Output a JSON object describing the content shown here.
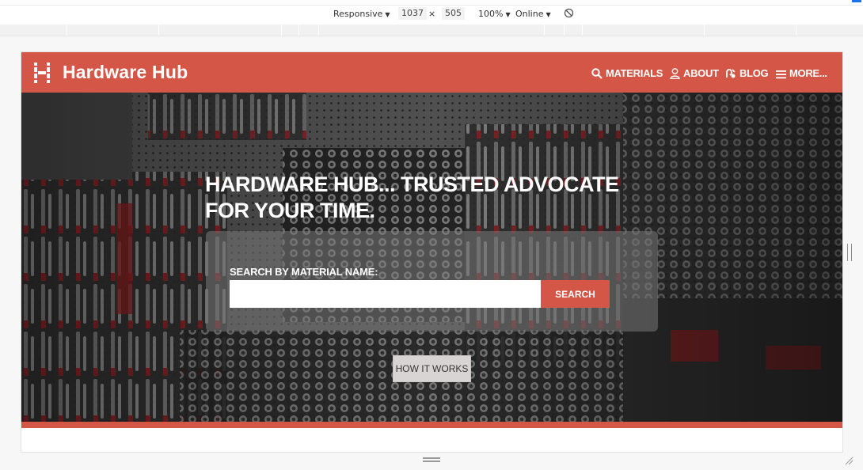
{
  "devtools": {
    "device": "Responsive",
    "width": "1037",
    "times": "×",
    "height": "505",
    "zoom": "100%",
    "network": "Online"
  },
  "site": {
    "brand": "Hardware Hub",
    "nav": [
      {
        "label": "MATERIALS",
        "icon": "search-icon"
      },
      {
        "label": "ABOUT",
        "icon": "user-icon"
      },
      {
        "label": "BLOG",
        "icon": "blog-icon"
      },
      {
        "label": "MORE...",
        "icon": "menu-icon"
      }
    ]
  },
  "hero": {
    "headline": "HARDWARE HUB... TRUSTED ADVOCATE FOR YOUR TIME.",
    "search_label": "SEARCH BY MATERIAL NAME:",
    "search_placeholder": "",
    "search_button": "SEARCH",
    "how_button": "HOW IT WORKS"
  },
  "colors": {
    "brand": "#d35646",
    "button_light": "#d9d4d4"
  }
}
